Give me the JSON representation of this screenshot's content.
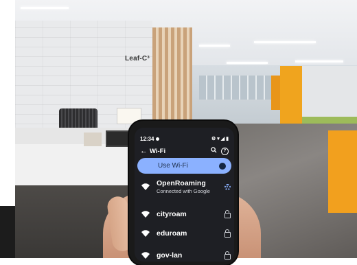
{
  "scene": {
    "wall_logo_text": "Leaf-C³"
  },
  "phone": {
    "status_bar": {
      "time": "12:34"
    },
    "app_bar": {
      "title": "Wi-Fi"
    },
    "use_wifi": {
      "label": "Use Wi-Fi",
      "enabled": true
    },
    "networks": [
      {
        "name": "OpenRoaming",
        "status": "Connected with Google",
        "trailing_icon": "gear-icon"
      },
      {
        "name": "cityroam",
        "status": "",
        "trailing_icon": "lock-icon"
      },
      {
        "name": "eduroam",
        "status": "",
        "trailing_icon": "lock-icon"
      },
      {
        "name": "gov-lan",
        "status": "",
        "trailing_icon": "lock-icon"
      }
    ],
    "colors": {
      "accent": "#8bb1ff",
      "screen_bg": "#1e1f24"
    }
  }
}
